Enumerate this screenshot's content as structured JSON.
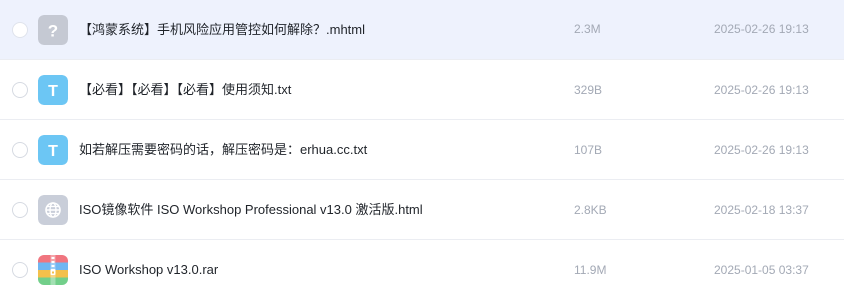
{
  "colors": {
    "selected_row_bg": "#eef2fd",
    "row_border": "#ebedf2",
    "name_text": "#1f2329",
    "meta_text": "#a3a9b5",
    "txt_icon_bg": "#6cc6f4",
    "unknown_icon_bg": "#c5c9d3",
    "web_icon_bg": "#c9ced9"
  },
  "files": [
    {
      "icon": "unknown-file-icon",
      "icon_glyph": "?",
      "name": "【鸿蒙系统】手机风险应用管控如何解除？.mhtml",
      "size": "2.3M",
      "date": "2025-02-26 19:13",
      "selected": true
    },
    {
      "icon": "txt-file-icon",
      "icon_glyph": "T",
      "name": "【必看】【必看】【必看】使用须知.txt",
      "size": "329B",
      "date": "2025-02-26 19:13",
      "selected": false
    },
    {
      "icon": "txt-file-icon",
      "icon_glyph": "T",
      "name": "如若解压需要密码的话，解压密码是：erhua.cc.txt",
      "size": "107B",
      "date": "2025-02-26 19:13",
      "selected": false
    },
    {
      "icon": "html-file-icon",
      "icon_glyph": "",
      "name": "ISO镜像软件 ISO Workshop Professional v13.0 激活版.html",
      "size": "2.8KB",
      "date": "2025-02-18 13:37",
      "selected": false
    },
    {
      "icon": "archive-file-icon",
      "icon_glyph": "",
      "name": "ISO Workshop v13.0.rar",
      "size": "11.9M",
      "date": "2025-01-05 03:37",
      "selected": false
    }
  ]
}
